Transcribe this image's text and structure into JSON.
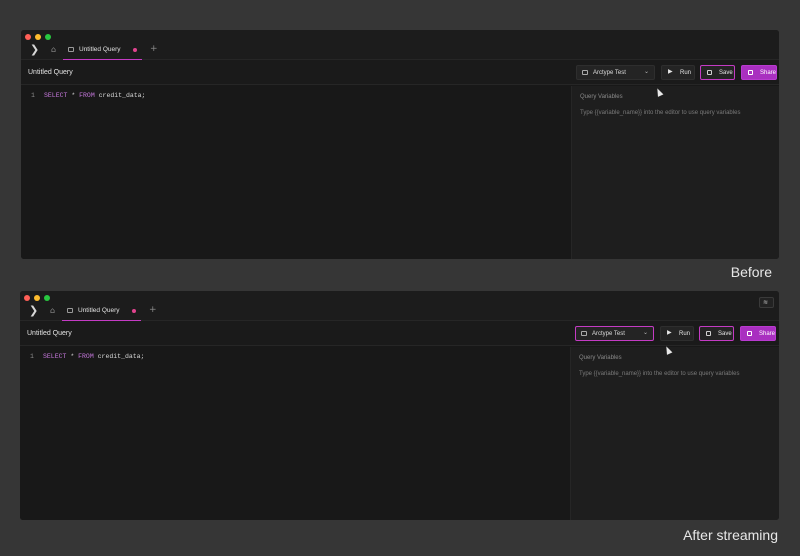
{
  "panels": [
    {
      "id": "before",
      "caption": "Before",
      "tab": {
        "label": "Untitled Query"
      },
      "toolbar": {
        "title": "Untitled Query",
        "connection": "Arctype Test",
        "run_label": "Run",
        "save_label": "Save",
        "share_label": "Share"
      },
      "editor": {
        "line_number": "1",
        "kw_select": "SELECT",
        "star": "*",
        "kw_from": "FROM",
        "table": "credit_data;"
      },
      "variables": {
        "title": "Query Variables",
        "hint": "Type {{variable_name}} into the editor to use query variables"
      }
    },
    {
      "id": "after",
      "caption": "After streaming",
      "tab": {
        "label": "Untitled Query"
      },
      "toolbar": {
        "title": "Untitled Query",
        "connection": "Arctype Test",
        "run_label": "Run",
        "save_label": "Save",
        "share_label": "Share"
      },
      "editor": {
        "line_number": "1",
        "kw_select": "SELECT",
        "star": "*",
        "kw_from": "FROM",
        "table": "credit_data;"
      },
      "variables": {
        "title": "Query Variables",
        "hint": "Type {{variable_name}} into the editor to use query variables"
      }
    }
  ],
  "icons": {
    "sidebar_toggle": "chevron-right-icon",
    "home": "home-icon",
    "tab": "query-tab-icon",
    "add_tab": "plus-icon",
    "wifi": "wifi-icon",
    "connection": "database-icon",
    "run": "play-icon",
    "save": "save-icon",
    "share": "share-icon"
  },
  "colors": {
    "accent": "#c43bc4",
    "share_button": "#a92fc0",
    "keyword": "#c678dd",
    "unsaved_dot": "#e0438f"
  }
}
